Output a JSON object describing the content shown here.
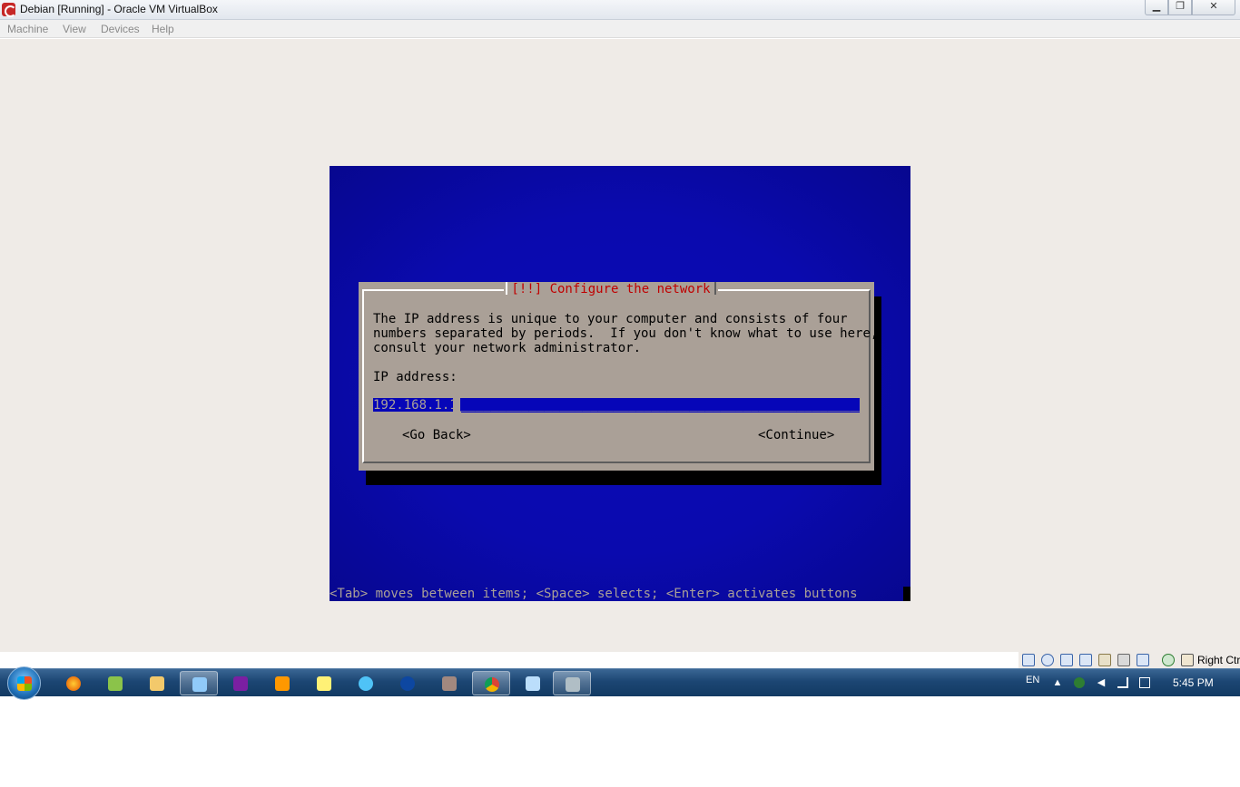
{
  "window": {
    "title": "Debian [Running] - Oracle VM VirtualBox",
    "minimize_icon": "minimize-icon",
    "maximize_icon": "restore-icon",
    "close_icon": "close-icon",
    "minimize_glyph": "▁",
    "maximize_glyph": "❐",
    "close_glyph": "✕"
  },
  "menu": {
    "items": [
      "Machine",
      "View",
      "Devices",
      "Help"
    ]
  },
  "installer": {
    "dialog_title": "[!!] Configure the network",
    "description": "The IP address is unique to your computer and consists of four\nnumbers separated by periods.  If you don't know what to use here,\nconsult your network administrator.",
    "field_label": "IP address:",
    "ip_value": "192.168.1.1",
    "field_fill": "______________________________________________________",
    "go_back": "<Go Back>",
    "continue": "<Continue>",
    "help_line": "<Tab> moves between items; <Space> selects; <Enter> activates buttons",
    "colors": {
      "background": "#0a0aae",
      "dialog": "#aaa097",
      "title": "#c00000",
      "field": "#0606b8"
    }
  },
  "status_bar": {
    "icons": [
      "hard-disk-icon",
      "optical-drive-icon",
      "usb-icon",
      "shared-folders-icon",
      "display-icon",
      "video-capture-icon",
      "network-icon",
      "virtualization-icon",
      "mouse-integration-icon",
      "keyboard-capture-icon"
    ],
    "host_key": "Right Ctrl"
  },
  "taskbar": {
    "apps": [
      "firefox-icon",
      "notepad-plus-icon",
      "file-explorer-icon",
      "paint-icon",
      "media-player-icon",
      "video-player-icon",
      "sticky-notes-icon",
      "network-tool-icon",
      "bluetooth-icon",
      "game-icon",
      "chrome-icon",
      "notepad-icon",
      "virtualbox-icon"
    ],
    "language": "EN",
    "clock": "5:45 PM"
  }
}
